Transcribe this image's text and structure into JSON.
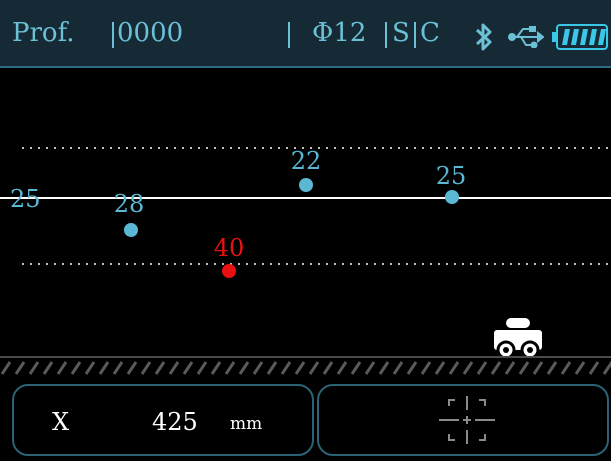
{
  "header": {
    "prof_label": "Prof.",
    "prof_value": "0000",
    "diameter": "Φ12",
    "mode_s": "S",
    "mode_c": "C",
    "icons": [
      "bluetooth-icon",
      "usb-icon",
      "battery-icon"
    ],
    "battery_level": 1.0
  },
  "plot": {
    "reference_label": "25",
    "points": [
      {
        "label": "28",
        "color": "#5bb8d4"
      },
      {
        "label": "40",
        "color": "#e81010"
      },
      {
        "label": "22",
        "color": "#5bb8d4"
      },
      {
        "label": "25",
        "color": "#5bb8d4"
      }
    ],
    "scanner_icon": "cart-icon"
  },
  "footer": {
    "axis_label": "X",
    "position_value": "425",
    "unit": "mm",
    "crosshair_icon": "crosshair-icon"
  },
  "colors": {
    "accent": "#6cc0d6",
    "header_bg": "#152a35",
    "marker": "#5bb8d4",
    "alert": "#e81010",
    "battery": "#3ac7e8"
  }
}
